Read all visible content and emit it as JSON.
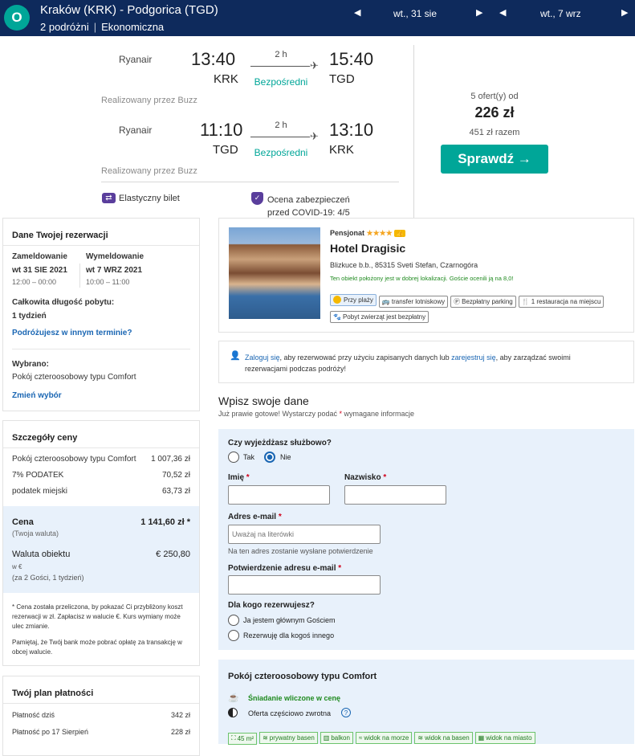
{
  "header": {
    "route": "Kraków (KRK) - Podgorica (TGD)",
    "passengers": "2 podróżni",
    "cabin": "Ekonomiczna",
    "depart_date": "wt., 31 sie",
    "return_date": "wt., 7 wrz",
    "logo_letter": "O"
  },
  "flights": [
    {
      "airline": "Ryanair",
      "dep_time": "13:40",
      "dep_code": "KRK",
      "duration": "2 h",
      "stops": "Bezpośredni",
      "arr_time": "15:40",
      "arr_code": "TGD",
      "operated": "Realizowany przez Buzz"
    },
    {
      "airline": "Ryanair",
      "dep_time": "11:10",
      "dep_code": "TGD",
      "duration": "2 h",
      "stops": "Bezpośredni",
      "arr_time": "13:10",
      "arr_code": "KRK",
      "operated": "Realizowany przez Buzz"
    }
  ],
  "badges": {
    "flexible": "Elastyczny bilet",
    "covid": "Ocena zabezpieczeń przed COVID-19: 4/5"
  },
  "offer": {
    "count": "5 ofert(y) od",
    "price": "226 zł",
    "total": "451 zł razem",
    "button": "Sprawdź →"
  },
  "booking": {
    "title": "Dane Twojej rezerwacji",
    "checkin_label": "Zameldowanie",
    "checkin_date": "wt 31 SIE 2021",
    "checkin_time": "12:00 – 00:00",
    "checkout_label": "Wymeldowanie",
    "checkout_date": "wt 7 WRZ 2021",
    "checkout_time": "10:00 – 11:00",
    "stay_label": "Całkowita długość pobytu:",
    "stay_value": "1 tydzień",
    "change_dates": "Podróżujesz w innym terminie?",
    "selected_label": "Wybrano:",
    "selected_value": "Pokój czteroosobowy typu Comfort",
    "change_selection": "Zmień wybór"
  },
  "price": {
    "title": "Szczegóły ceny",
    "rows": [
      {
        "label": "Pokój czteroosobowy typu Comfort",
        "value": "1 007,36 zł"
      },
      {
        "label": "7% PODATEK",
        "value": "70,52 zł"
      },
      {
        "label": "podatek miejski",
        "value": "63,73 zł"
      }
    ],
    "total_label": "Cena",
    "total_sub": "(Twoja waluta)",
    "total_value": "1 141,60 zł *",
    "local_label": "Waluta obiektu",
    "local_sub1": "w €",
    "local_sub2": "(za 2 Gości,   1 tydzień)",
    "local_value": "€ 250,80",
    "note1": "* Cena została przeliczona, by pokazać Ci przybliżony koszt rezerwacji w zł. Zapłacisz w walucie €. Kurs wymiany może ulec zmianie.",
    "note2": "Pamiętaj, że Twój bank może pobrać opłatę za transakcję w obcej walucie."
  },
  "plan": {
    "title": "Twój plan płatności",
    "rows": [
      {
        "label": "Płatność dziś",
        "value": "342 zł"
      },
      {
        "label": "Płatność po 17 Sierpień",
        "value": "228 zł"
      }
    ]
  },
  "hotel": {
    "type": "Pensjonat",
    "stars": "★★★★",
    "thumb": "👍",
    "name": "Hotel Dragisic",
    "address": "Blizkuce b.b., 85315 Sveti Stefan, Czarnogóra",
    "location_note": "Ten obiekt położony jest w dobrej lokalizacji. Goście ocenili ją na 8,0!",
    "amenities": [
      "Przy plaży",
      "transfer lotniskowy",
      "Bezpłatny parking",
      "1 restauracja na miejscu",
      "Pobyt zwierząt jest bezpłatny"
    ]
  },
  "login": {
    "link1": "Zaloguj się",
    "text1": ", aby rezerwować przy użyciu zapisanych danych lub ",
    "link2": "zarejestruj się",
    "text2": ", aby zarządzać swoimi",
    "line2": "rezerwacjami podczas podróży!"
  },
  "form": {
    "title": "Wpisz swoje dane",
    "subtitle_pre": "Już prawie gotowe! Wystarczy podać ",
    "subtitle_post": " wymagane informacje",
    "business_q": "Czy wyjeżdżasz służbowo?",
    "yes": "Tak",
    "no": "Nie",
    "first_name": "Imię",
    "last_name": "Nazwisko",
    "email": "Adres e-mail",
    "email_placeholder": "Uważaj na literówki",
    "email_hint": "Na ten adres zostanie wysłane potwierdzenie",
    "email_confirm": "Potwierdzenie adresu e-mail",
    "who_q": "Dla kogo rezerwujesz?",
    "who_opt1": "Ja jestem głównym Gościem",
    "who_opt2": "Rezerwuję dla kogoś innego"
  },
  "room": {
    "title": "Pokój czteroosobowy typu Comfort",
    "breakfast": "Śniadanie wliczone w cenę",
    "refund": "Oferta częściowo zwrotna",
    "tags": [
      "45 m²",
      "prywatny basen",
      "balkon",
      "widok na morze",
      "widok na basen",
      "widok na miasto"
    ]
  },
  "colors": {
    "navy": "#0e2a5c",
    "teal": "#00a698",
    "link": "#1a66b3"
  }
}
